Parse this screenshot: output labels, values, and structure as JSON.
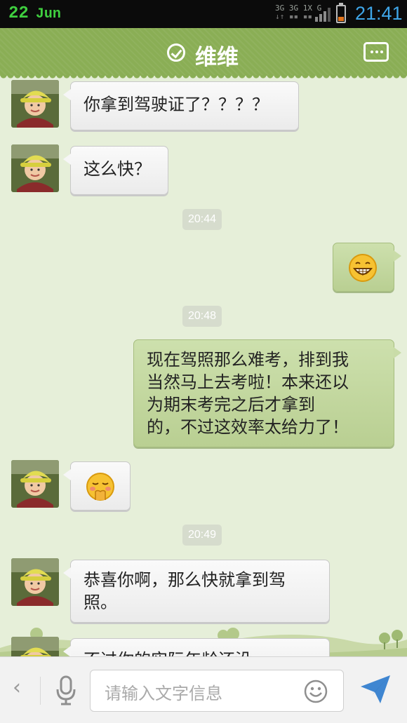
{
  "status_bar": {
    "date_day": "22",
    "date_month": "Jun",
    "network_labels": [
      "3G",
      "3G",
      "1X",
      "G"
    ],
    "time": "21:41",
    "battery_color": "#e2731a"
  },
  "header": {
    "title": "维维",
    "status_icon": "check-circle-icon",
    "more_icon": "more-dots-icon",
    "color": "#8aae55"
  },
  "messages": [
    {
      "side": "in",
      "type": "text",
      "text": "你拿到驾驶证了？？？？"
    },
    {
      "side": "in",
      "type": "text",
      "text": "这么快？"
    },
    {
      "type": "timestamp",
      "text": "20:44"
    },
    {
      "side": "out",
      "type": "emoji",
      "emoji": "grin-emoji"
    },
    {
      "type": "timestamp",
      "text": "20:48"
    },
    {
      "side": "out",
      "type": "text",
      "lines": [
        "现在驾照那么难考，排到我",
        "当然马上去考啦！本来还以",
        "为期末考完之后才拿到",
        "的，不过这效率太给力了！"
      ]
    },
    {
      "side": "in",
      "type": "emoji",
      "emoji": "shy-emoji"
    },
    {
      "type": "timestamp",
      "text": "20:49"
    },
    {
      "side": "in",
      "type": "text",
      "lines": [
        "恭喜你啊，那么快就拿到驾",
        "照。"
      ]
    },
    {
      "side": "in",
      "type": "text",
      "text": "不过你的实际年龄还没"
    }
  ],
  "input_bar": {
    "back_icon": "back-chevron-icon",
    "voice_icon": "microphone-icon",
    "placeholder": "请输入文字信息",
    "emoji_icon": "smiley-icon",
    "send_icon": "send-icon"
  }
}
